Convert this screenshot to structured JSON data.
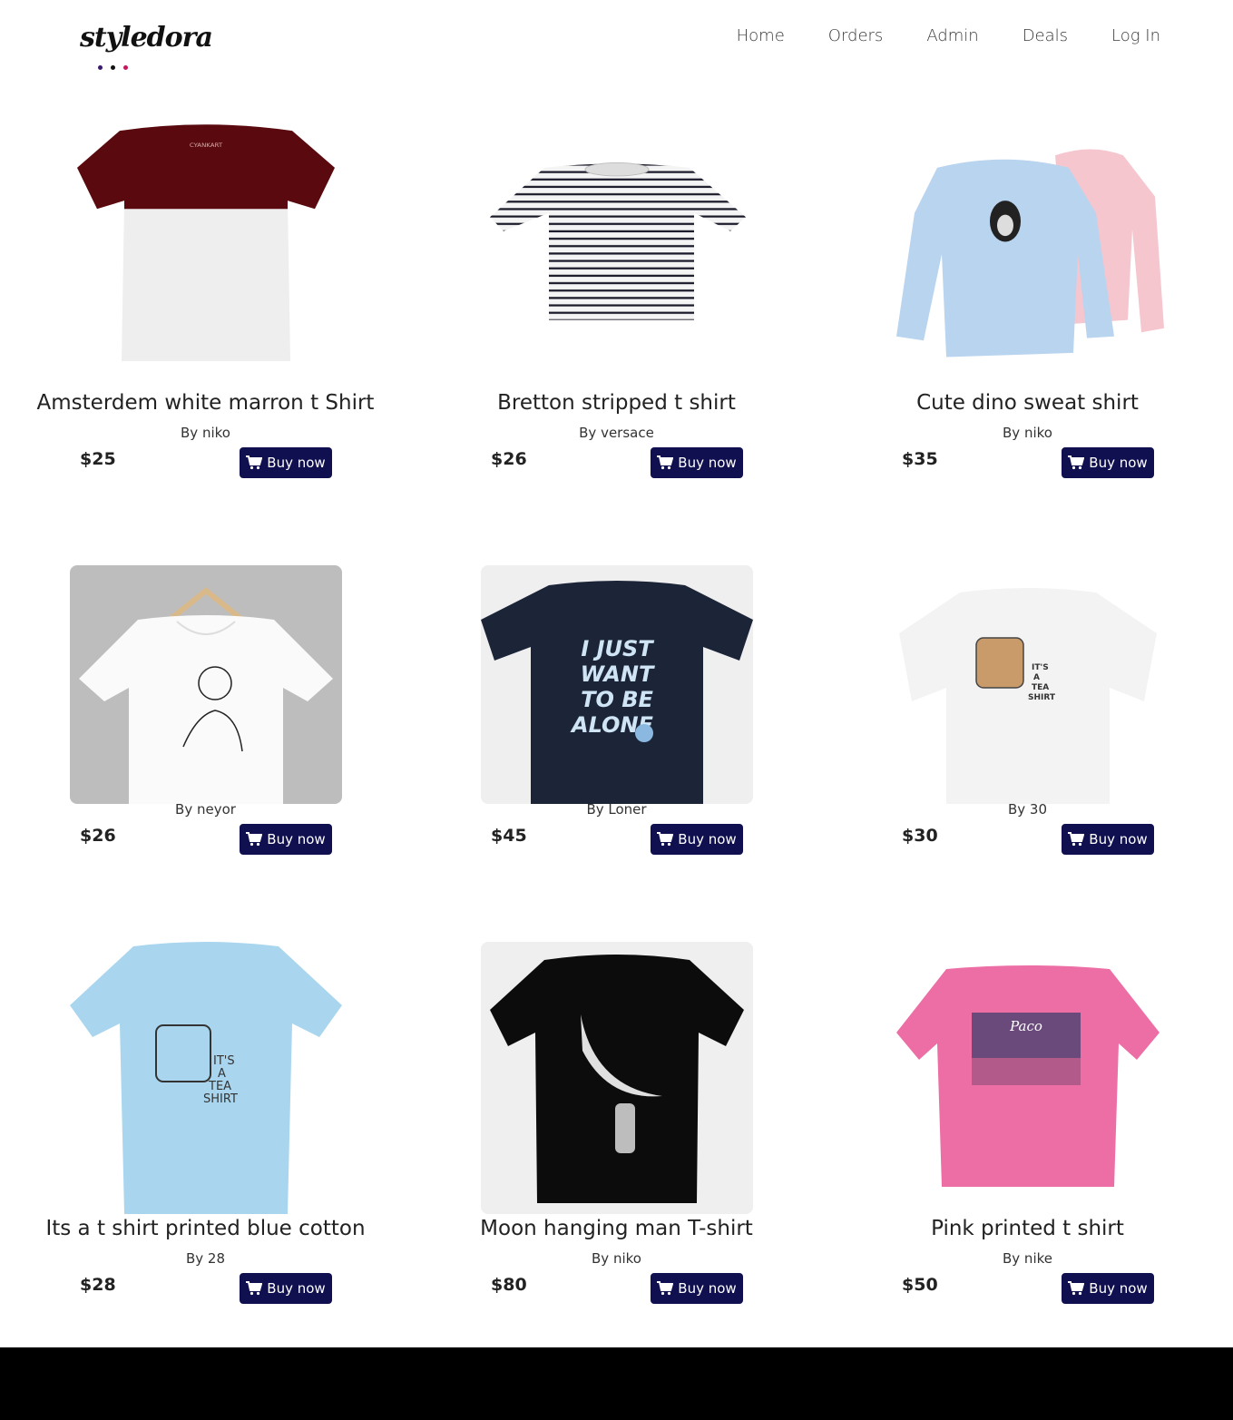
{
  "brand": {
    "logo_text": "styledora",
    "dot_colors": [
      "#3a1a6e",
      "#111111",
      "#c2185b"
    ]
  },
  "nav": {
    "items": [
      "Home",
      "Orders",
      "Admin",
      "Deals",
      "Log In"
    ]
  },
  "buy_label": "Buy now",
  "products": [
    {
      "title": "Amsterdem white marron t Shirt",
      "by": "By niko",
      "price": "$25",
      "image": "maroon-white-tshirt"
    },
    {
      "title": "Bretton stripped t shirt",
      "by": "By versace",
      "price": "$26",
      "image": "striped-tshirt"
    },
    {
      "title": "Cute dino sweat shirt",
      "by": "By niko",
      "price": "$35",
      "image": "dino-sweatshirts"
    },
    {
      "title": "",
      "by": "By neyor",
      "price": "$26",
      "image": "white-tshirt-on-hanger"
    },
    {
      "title": "",
      "by": "By Loner",
      "price": "$45",
      "image": "navy-i-just-want-to-be-alone-tshirt"
    },
    {
      "title": "",
      "by": "By 30",
      "price": "$30",
      "image": "white-tea-shirt"
    },
    {
      "title": "Its a t shirt printed blue cotton",
      "by": "By 28",
      "price": "$28",
      "image": "blue-tea-shirt"
    },
    {
      "title": "Moon hanging man T-shirt",
      "by": "By niko",
      "price": "$80",
      "image": "black-moon-tshirt"
    },
    {
      "title": "Pink printed t shirt",
      "by": "By nike",
      "price": "$50",
      "image": "pink-printed-tshirt"
    }
  ],
  "print_text": {
    "tea": [
      "IT'S",
      "A",
      "TEA",
      "SHIRT"
    ],
    "alone": [
      "I JUST",
      "WANT",
      "TO BE",
      "ALONE"
    ],
    "paco": "Paco",
    "cyankart": "CYANKART"
  }
}
